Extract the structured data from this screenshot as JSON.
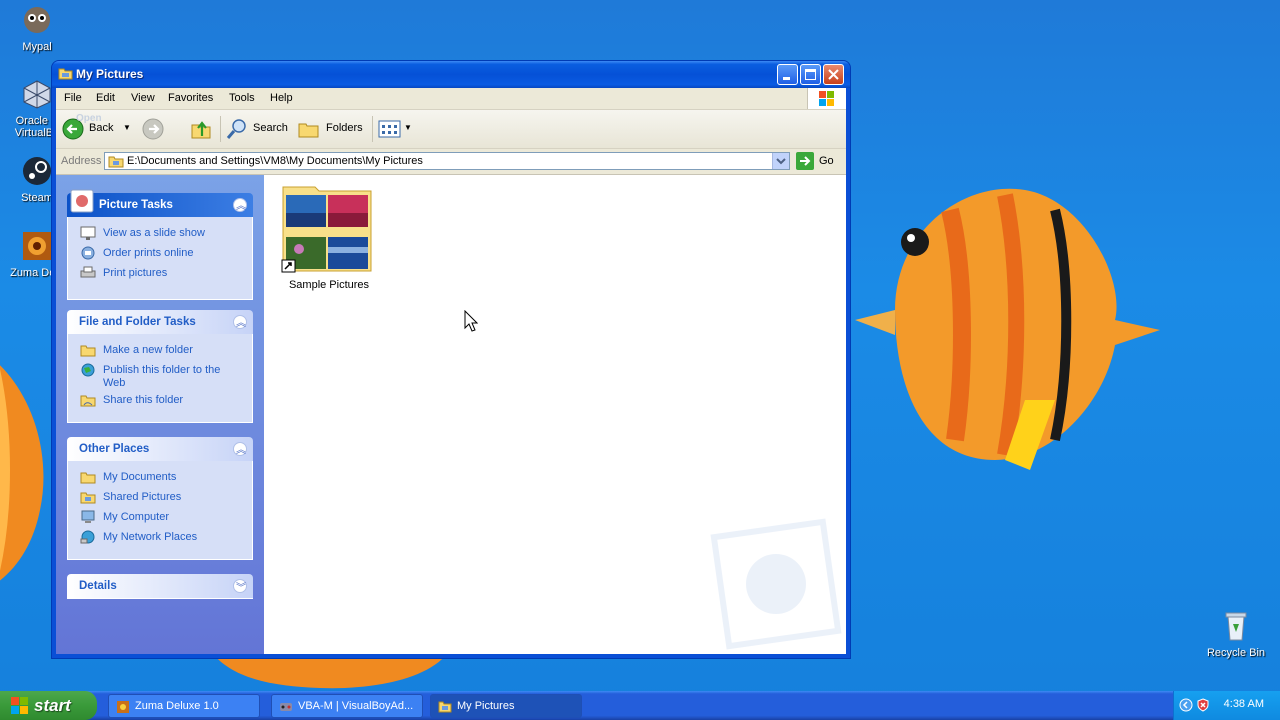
{
  "desktop": {
    "icons": [
      {
        "label": "Mypal"
      },
      {
        "label": "Oracle VM VirtualBox",
        "line1": "Oracle V",
        "line2": "VirtualBo"
      },
      {
        "label": "Steam"
      },
      {
        "label": "Zuma Deluxe",
        "line1": "Zuma Delu"
      },
      {
        "label": "Recycle Bin"
      }
    ]
  },
  "window": {
    "title": "My Pictures",
    "menu": [
      "File",
      "Edit",
      "View",
      "Favorites",
      "Tools",
      "Help"
    ],
    "toolbar": {
      "back": "Back",
      "search": "Search",
      "folders": "Folders",
      "tooltip": "Open"
    },
    "address": {
      "label": "Address",
      "value": "E:\\Documents and Settings\\VM8\\My Documents\\My Pictures",
      "go": "Go"
    },
    "tasks_panels": [
      {
        "title": "Picture Tasks",
        "items": [
          "View as a slide show",
          "Order prints online",
          "Print pictures"
        ]
      },
      {
        "title": "File and Folder Tasks",
        "items": [
          "Make a new folder",
          "Publish this folder to the Web",
          "Share this folder"
        ]
      },
      {
        "title": "Other Places",
        "items": [
          "My Documents",
          "Shared Pictures",
          "My Computer",
          "My Network Places"
        ]
      },
      {
        "title": "Details",
        "items": []
      }
    ],
    "content": {
      "items": [
        {
          "label": "Sample Pictures"
        }
      ]
    }
  },
  "taskbar": {
    "start": "start",
    "tasks": [
      "Zuma Deluxe 1.0",
      "VBA-M | VisualBoyAd...",
      "My Pictures"
    ],
    "clock": "4:38 AM"
  }
}
